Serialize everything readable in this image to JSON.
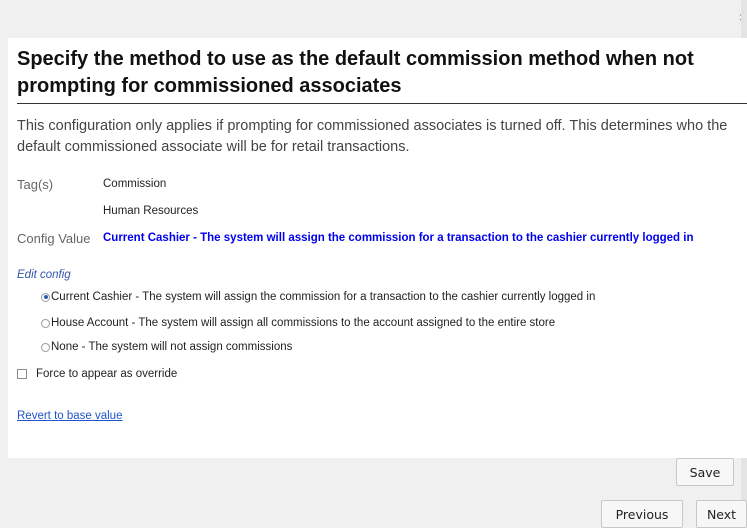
{
  "dialog": {
    "close_glyph": "×",
    "title": "Specify the method to use as the default commission method when not prompting for commissioned associates",
    "description": "This configuration only applies if prompting for commissioned associates is turned off. This determines who the default commissioned associate will be for retail transactions.",
    "tags_label": "Tag(s)",
    "tags": [
      "Commission",
      "Human Resources"
    ],
    "config_value_label": "Config Value",
    "config_value": "Current Cashier - The system will assign the commission for a transaction to the cashier currently logged in",
    "edit_config_label": "Edit config",
    "options": [
      {
        "label": "Current Cashier - The system will assign the commission for a transaction to the cashier currently logged in",
        "selected": true
      },
      {
        "label": "House Account - The system will assign all commissions to the account assigned to the entire store",
        "selected": false
      },
      {
        "label": "None - The system will not assign commissions",
        "selected": false
      }
    ],
    "force_override_label": "Force to appear as override",
    "force_override_checked": false,
    "revert_link": "Revert to base value"
  },
  "buttons": {
    "save": "Save",
    "previous": "Previous",
    "next": "Next"
  },
  "colors": {
    "config_value": "#0000ee",
    "link": "#2255cc",
    "radio_selected": "#2a5db0"
  }
}
